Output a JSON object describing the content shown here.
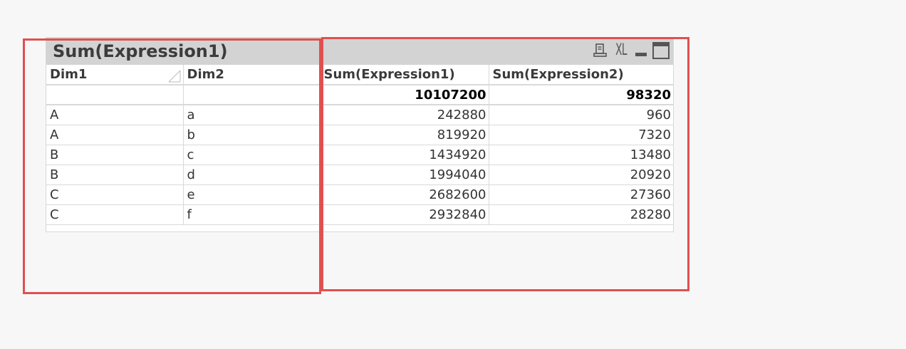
{
  "table": {
    "caption": "Sum(Expression1)",
    "icons": [
      "print-icon",
      "xl-export-icon",
      "minimize-icon",
      "maximize-icon"
    ],
    "xl_label": "XL",
    "columns": [
      "Dim1",
      "Dim2",
      "Sum(Expression1)",
      "Sum(Expression2)"
    ],
    "sorted_column": "Dim1",
    "totals": [
      "",
      "",
      "10107200",
      "98320"
    ],
    "rows": [
      [
        "A",
        "a",
        "242880",
        "960"
      ],
      [
        "A",
        "b",
        "819920",
        "7320"
      ],
      [
        "B",
        "c",
        "1434920",
        "13480"
      ],
      [
        "B",
        "d",
        "1994040",
        "20920"
      ],
      [
        "C",
        "e",
        "2682600",
        "27360"
      ],
      [
        "C",
        "f",
        "2932840",
        "28280"
      ]
    ]
  },
  "colors": {
    "caption_bg": "#d3d3d3",
    "highlight": "#e05050",
    "background": "#f7f7f7"
  }
}
